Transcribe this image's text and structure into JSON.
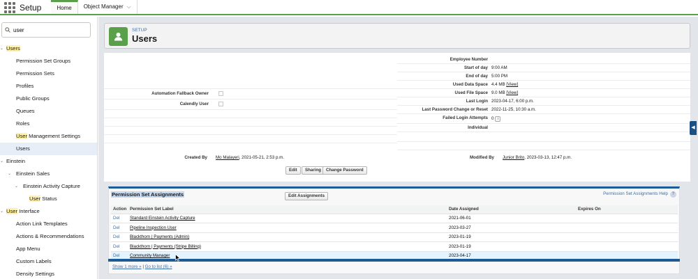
{
  "topbar": {
    "app_name": "Setup",
    "tabs": [
      {
        "label": "Home"
      },
      {
        "label": "Object Manager"
      }
    ]
  },
  "sidebar": {
    "search_value": "user",
    "items": [
      {
        "label": "Users",
        "match": "Users",
        "rest": ""
      },
      {
        "label": "Permission Set Groups"
      },
      {
        "label": "Permission Sets"
      },
      {
        "label": "Profiles"
      },
      {
        "label": "Public Groups"
      },
      {
        "label": "Queues"
      },
      {
        "label": "Roles"
      },
      {
        "label": "User Management Settings",
        "match": "User",
        "rest": " Management Settings"
      },
      {
        "label": "Users"
      },
      {
        "label": "Einstein"
      },
      {
        "label": "Einstein Sales"
      },
      {
        "label": "Einstein Activity Capture"
      },
      {
        "label": "User Status",
        "match": "User",
        "rest": " Status"
      },
      {
        "label": "User Interface",
        "match": "User",
        "rest": " Interface"
      },
      {
        "label": "Action Link Templates"
      },
      {
        "label": "Actions & Recommendations"
      },
      {
        "label": "App Menu"
      },
      {
        "label": "Custom Labels"
      },
      {
        "label": "Density Settings"
      }
    ]
  },
  "header": {
    "eyebrow": "SETUP",
    "title": "Users"
  },
  "detail": {
    "left": {
      "automation_fallback_owner": "Automation Fallback Owner",
      "calendly_user": "Calendly User",
      "created_by_label": "Created By",
      "created_by_name": "Mo Malayeri",
      "created_by_date": ", 2021-05-21, 2:53 p.m."
    },
    "right": {
      "employee_number": "Employee Number",
      "start_of_day_label": "Start of day",
      "start_of_day": "9:00 AM",
      "end_of_day_label": "End of day",
      "end_of_day": "5:00 PM",
      "used_data_space_label": "Used Data Space",
      "used_data_space": "4.4 MB",
      "used_file_space_label": "Used File Space",
      "used_file_space": "9.0 MB",
      "view_link": "[View]",
      "last_login_label": "Last Login",
      "last_login": "2023-04-17, 6:00 p.m.",
      "last_pw_label": "Last Password Change or Reset",
      "last_pw": "2022-11-25, 10:30 a.m.",
      "failed_login_label": "Failed Login Attempts",
      "failed_login": "0",
      "individual_label": "Individual",
      "modified_by_label": "Modified By",
      "modified_by_name": "Junior Brito",
      "modified_by_date": ", 2023-03-13, 12:47 p.m."
    },
    "buttons": {
      "edit": "Edit",
      "sharing": "Sharing",
      "change_password": "Change Password"
    }
  },
  "related_list": {
    "title": "Permission Set Assignments",
    "edit_button": "Edit Assignments",
    "help_link": "Permission Set Assignments Help",
    "help_icon": "?",
    "columns": {
      "action": "Action",
      "label": "Permission Set Label",
      "date": "Date Assigned",
      "expires": "Expires On"
    },
    "rows": [
      {
        "action": "Del",
        "label": "Standard Einstein Activity Capture",
        "date": "2021-06-01",
        "expires": ""
      },
      {
        "action": "Del",
        "label": "Pipeline Inspection User",
        "date": "2023-03-27",
        "expires": ""
      },
      {
        "action": "Del",
        "label": "Blackthorn | Payments (Admin)",
        "date": "2023-01-19",
        "expires": ""
      },
      {
        "action": "Del",
        "label": "Blackthorn | Payments (Stripe Billing)",
        "date": "2023-01-19",
        "expires": ""
      },
      {
        "action": "Del",
        "label": "Community Manager",
        "date": "2023-04-17",
        "expires": ""
      }
    ],
    "show_more": "Show 1 more »",
    "separator": " | ",
    "go_to_list": "Go to list (6) »"
  }
}
